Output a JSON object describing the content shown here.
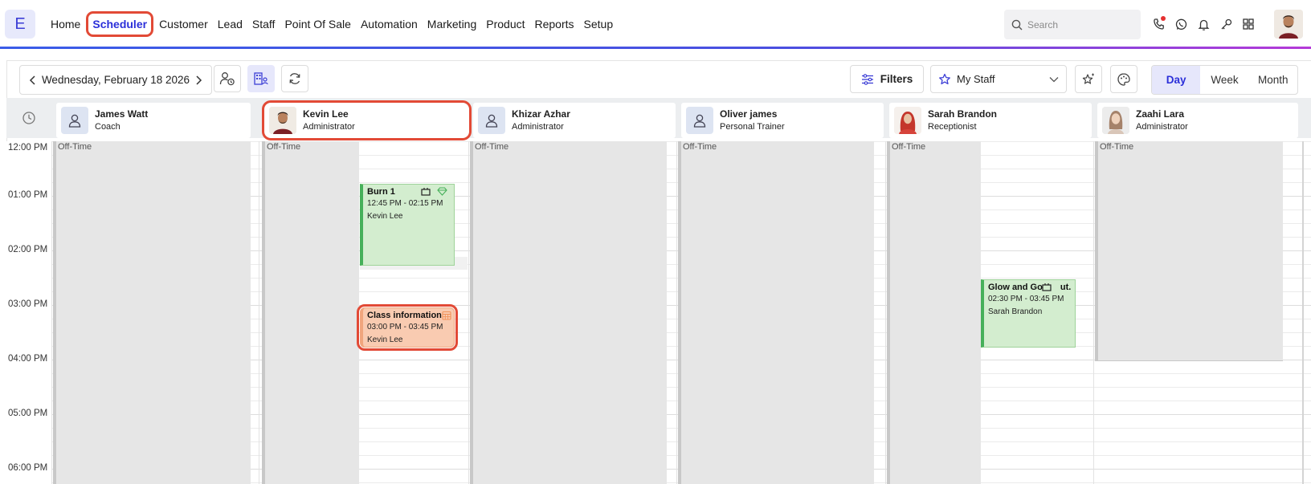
{
  "logo": {
    "letter": "E"
  },
  "nav": [
    {
      "label": "Home",
      "active": false
    },
    {
      "label": "Scheduler",
      "active": true
    },
    {
      "label": "Customer",
      "active": false
    },
    {
      "label": "Lead",
      "active": false
    },
    {
      "label": "Staff",
      "active": false
    },
    {
      "label": "Point Of Sale",
      "active": false
    },
    {
      "label": "Automation",
      "active": false
    },
    {
      "label": "Marketing",
      "active": false
    },
    {
      "label": "Product",
      "active": false
    },
    {
      "label": "Reports",
      "active": false
    },
    {
      "label": "Setup",
      "active": false
    }
  ],
  "search": {
    "placeholder": "Search"
  },
  "top_icons": [
    "phone-icon",
    "whatsapp-icon",
    "bell-icon",
    "key-icon",
    "apps-grid-icon"
  ],
  "toolbar": {
    "date": "Wednesday, February 18 2026",
    "filters_label": "Filters",
    "staff_select": "My Staff",
    "views": [
      {
        "label": "Day",
        "active": true
      },
      {
        "label": "Week",
        "active": false
      },
      {
        "label": "Month",
        "active": false
      }
    ]
  },
  "staff": [
    {
      "name": "James Watt",
      "role": "Coach",
      "avatar": "generic"
    },
    {
      "name": "Kevin Lee",
      "role": "Administrator",
      "avatar": "photo-man"
    },
    {
      "name": "Khizar Azhar",
      "role": "Administrator",
      "avatar": "generic"
    },
    {
      "name": "Oliver james",
      "role": "Personal Trainer",
      "avatar": "generic"
    },
    {
      "name": "Sarah Brandon",
      "role": "Receptionist",
      "avatar": "photo-woman-red"
    },
    {
      "name": "Zaahi Lara",
      "role": "Administrator",
      "avatar": "photo-woman"
    }
  ],
  "times": [
    "12:00 PM",
    "01:00 PM",
    "02:00 PM",
    "03:00 PM",
    "04:00 PM",
    "05:00 PM",
    "06:00 PM"
  ],
  "offtime_label": "Off-Time",
  "events": [
    {
      "title": "Burn 1",
      "time": "12:45 PM - 02:15 PM",
      "staff": "Kevin Lee",
      "color": "green"
    },
    {
      "title": "Class information",
      "time": "03:00 PM - 03:45 PM",
      "staff": "Kevin Lee",
      "color": "orange"
    },
    {
      "title": "Glow and Go",
      "title_suffix": "ut..",
      "time": "02:30 PM - 03:45 PM",
      "staff": "Sarah Brandon",
      "color": "green"
    }
  ],
  "colors": {
    "accent": "#2b2fd9",
    "highlight": "#e24a36",
    "event_green": "#d3edcf",
    "event_orange": "#f9cbb1",
    "offtime": "#e6e6e6"
  }
}
